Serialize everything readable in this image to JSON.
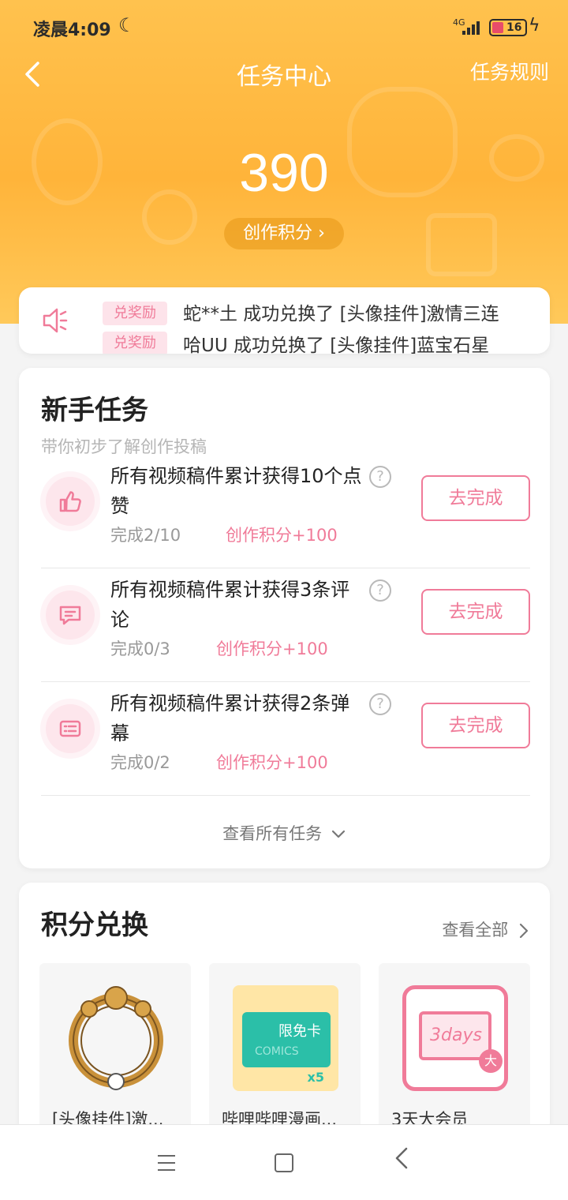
{
  "status_bar": {
    "time": "凌晨4:09",
    "network": "4G",
    "battery": "16"
  },
  "header": {
    "back_icon": "back-arrow-icon",
    "title": "任务中心",
    "rules_link": "任务规则"
  },
  "points": {
    "value": "390",
    "label": "创作积分"
  },
  "notice": {
    "tag": "兑奖励",
    "message": "蛇**土 成功兑换了 [头像挂件]激情三连",
    "tag_next": "兑奖励",
    "message_next": "哈UU 成功兑换了 [头像挂件]蓝宝石星"
  },
  "newbie_tasks": {
    "title": "新手任务",
    "subtitle": "带你初步了解创作投稿",
    "items": [
      {
        "icon": "thumbs-up-icon",
        "title": "所有视频稿件累计获得10个点赞",
        "progress": "完成2/10",
        "reward": "创作积分+100",
        "button": "去完成"
      },
      {
        "icon": "comment-icon",
        "title": "所有视频稿件累计获得3条评论",
        "progress": "完成0/3",
        "reward": "创作积分+100",
        "button": "去完成"
      },
      {
        "icon": "danmaku-icon",
        "title": "所有视频稿件累计获得2条弹幕",
        "progress": "完成0/2",
        "reward": "创作积分+100",
        "button": "去完成"
      }
    ],
    "see_all": "查看所有任务"
  },
  "points_exchange": {
    "title": "积分兑换",
    "see_all": "查看全部",
    "items": [
      {
        "icon": "avatar-frame-icon",
        "name": "[头像挂件]激..."
      },
      {
        "icon": "comic-card-icon",
        "name": "哔哩哔哩漫画...",
        "card_text": "限免卡",
        "card_word": "COMICS",
        "multiplier": "x5"
      },
      {
        "icon": "vip-card-icon",
        "name": "3天大会员",
        "card_text": "3days",
        "badge": "大"
      }
    ]
  },
  "colors": {
    "accent_pink": "#f07b99",
    "hero_orange": "#ffb43a"
  }
}
